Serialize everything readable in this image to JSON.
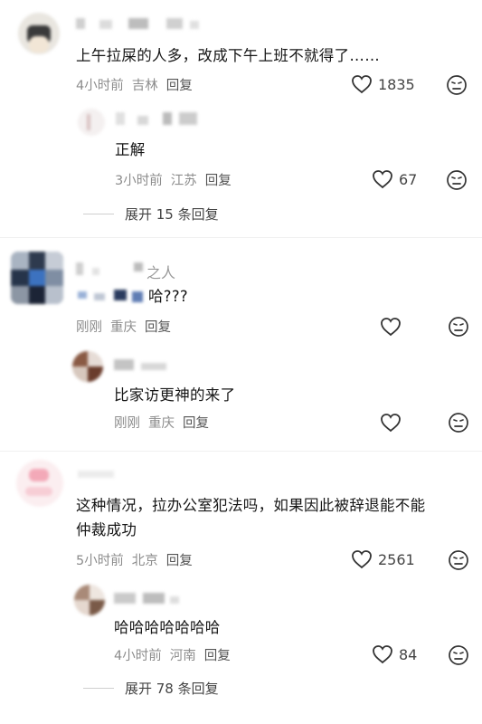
{
  "comments": [
    {
      "text": "上午拉屎的人多，改成下午上班不就得了……",
      "time": "4小时前",
      "location": "吉林",
      "reply": "回复",
      "likes": "1835",
      "sub": {
        "text": "正解",
        "time": "3小时前",
        "location": "江苏",
        "reply": "回复",
        "likes": "67"
      },
      "expand": "展开 15 条回复"
    },
    {
      "name_suffix": "之人",
      "text": "哈???",
      "time": "刚刚",
      "location": "重庆",
      "reply": "回复",
      "likes": "",
      "sub": {
        "text": "比家访更神的来了",
        "time": "刚刚",
        "location": "重庆",
        "reply": "回复",
        "likes": ""
      }
    },
    {
      "text_line1": "这种情况，拉办公室犯法吗，如果因此被辞退能不能",
      "text_line2": "仲裁成功",
      "time": "5小时前",
      "location": "北京",
      "reply": "回复",
      "likes": "2561",
      "sub": {
        "text": "哈哈哈哈哈哈哈",
        "time": "4小时前",
        "location": "河南",
        "reply": "回复",
        "likes": "84"
      },
      "expand": "展开 78 条回复"
    }
  ],
  "icons": {
    "like": "heart-outline-icon",
    "dislike": "meh-face-icon"
  }
}
